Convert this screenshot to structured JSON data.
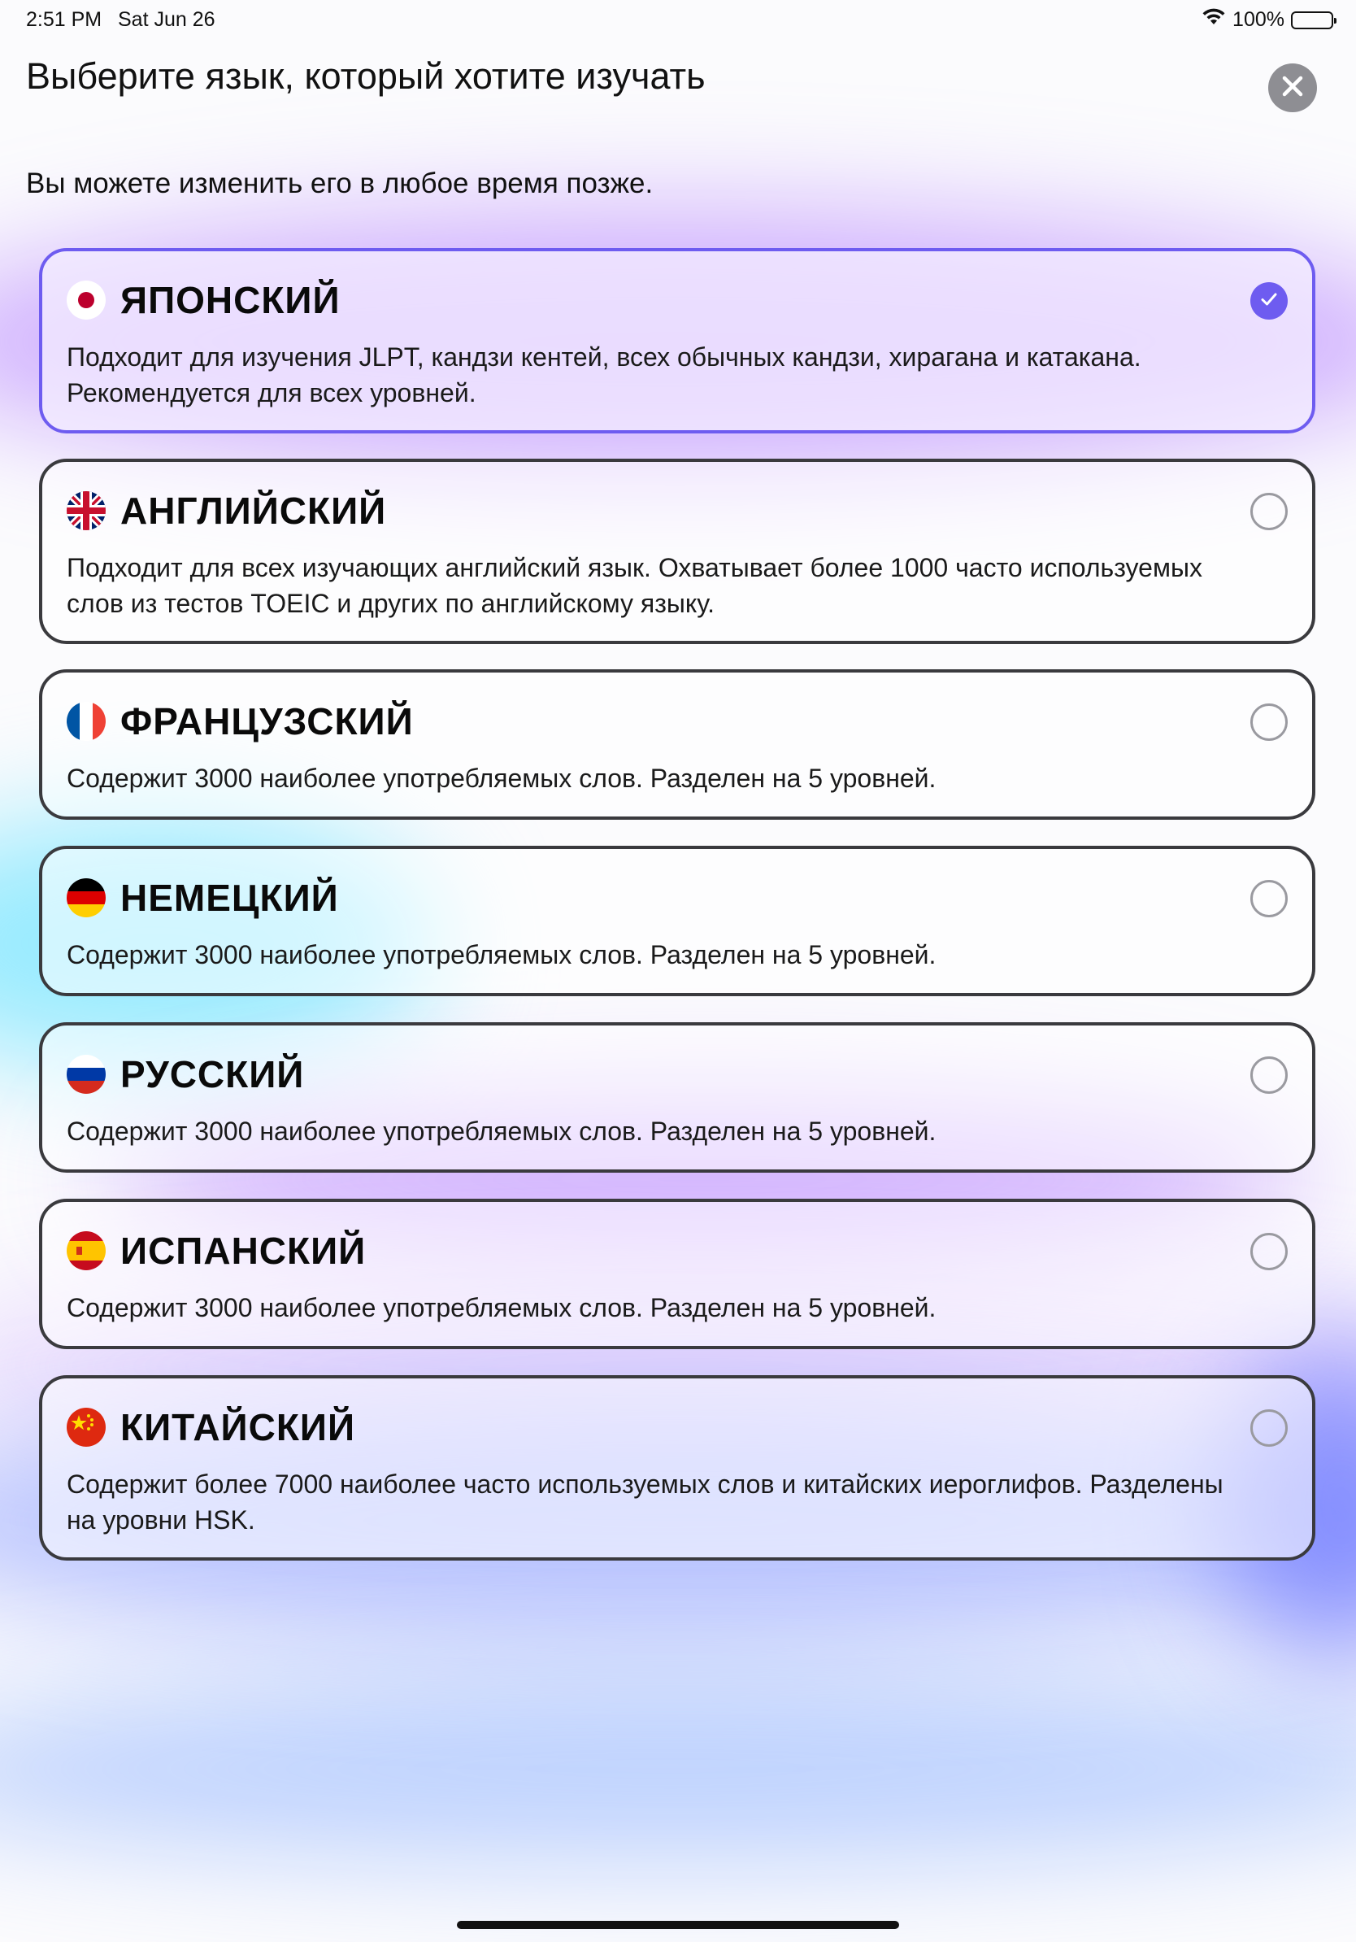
{
  "status_bar": {
    "time": "2:51 PM",
    "date": "Sat Jun 26",
    "battery": "100%",
    "wifi_icon": "wifi-icon",
    "battery_level": 1.0
  },
  "header": {
    "title": "Выберите язык, который хотите изучать",
    "close_icon": "close-icon"
  },
  "subtitle": "Вы можете изменить его в любое время позже.",
  "colors": {
    "accent": "#6e5cf0",
    "card_border": "#3a3a3e",
    "close_button": "#8e8e93"
  },
  "languages": [
    {
      "flag": "japan-flag-icon",
      "name": "ЯПОНСКИЙ",
      "description": "Подходит для изучения JLPT, кандзи кентей, всех обычных кандзи, хирагана и катакана. Рекомендуется для всех уровней.",
      "selected": true
    },
    {
      "flag": "uk-flag-icon",
      "name": "АНГЛИЙСКИЙ",
      "description": "Подходит для всех изучающих английский язык. Охватывает более 1000 часто используемых слов из тестов TOEIC и других по английскому языку.",
      "selected": false
    },
    {
      "flag": "france-flag-icon",
      "name": "ФРАНЦУЗСКИЙ",
      "description": "Содержит 3000 наиболее употребляемых слов. Разделен на 5 уровней.",
      "selected": false
    },
    {
      "flag": "germany-flag-icon",
      "name": "НЕМЕЦКИЙ",
      "description": "Содержит 3000 наиболее употребляемых слов. Разделен на 5 уровней.",
      "selected": false
    },
    {
      "flag": "russia-flag-icon",
      "name": "РУССКИЙ",
      "description": "Содержит 3000 наиболее употребляемых слов. Разделен на 5 уровней.",
      "selected": false
    },
    {
      "flag": "spain-flag-icon",
      "name": "ИСПАНСКИЙ",
      "description": "Содержит 3000 наиболее употребляемых слов. Разделен на 5 уровней.",
      "selected": false
    },
    {
      "flag": "china-flag-icon",
      "name": "КИТАЙСКИЙ",
      "description": "Содержит более 7000 наиболее часто используемых слов и китайских иероглифов. Разделены на уровни HSK.",
      "selected": false
    }
  ]
}
